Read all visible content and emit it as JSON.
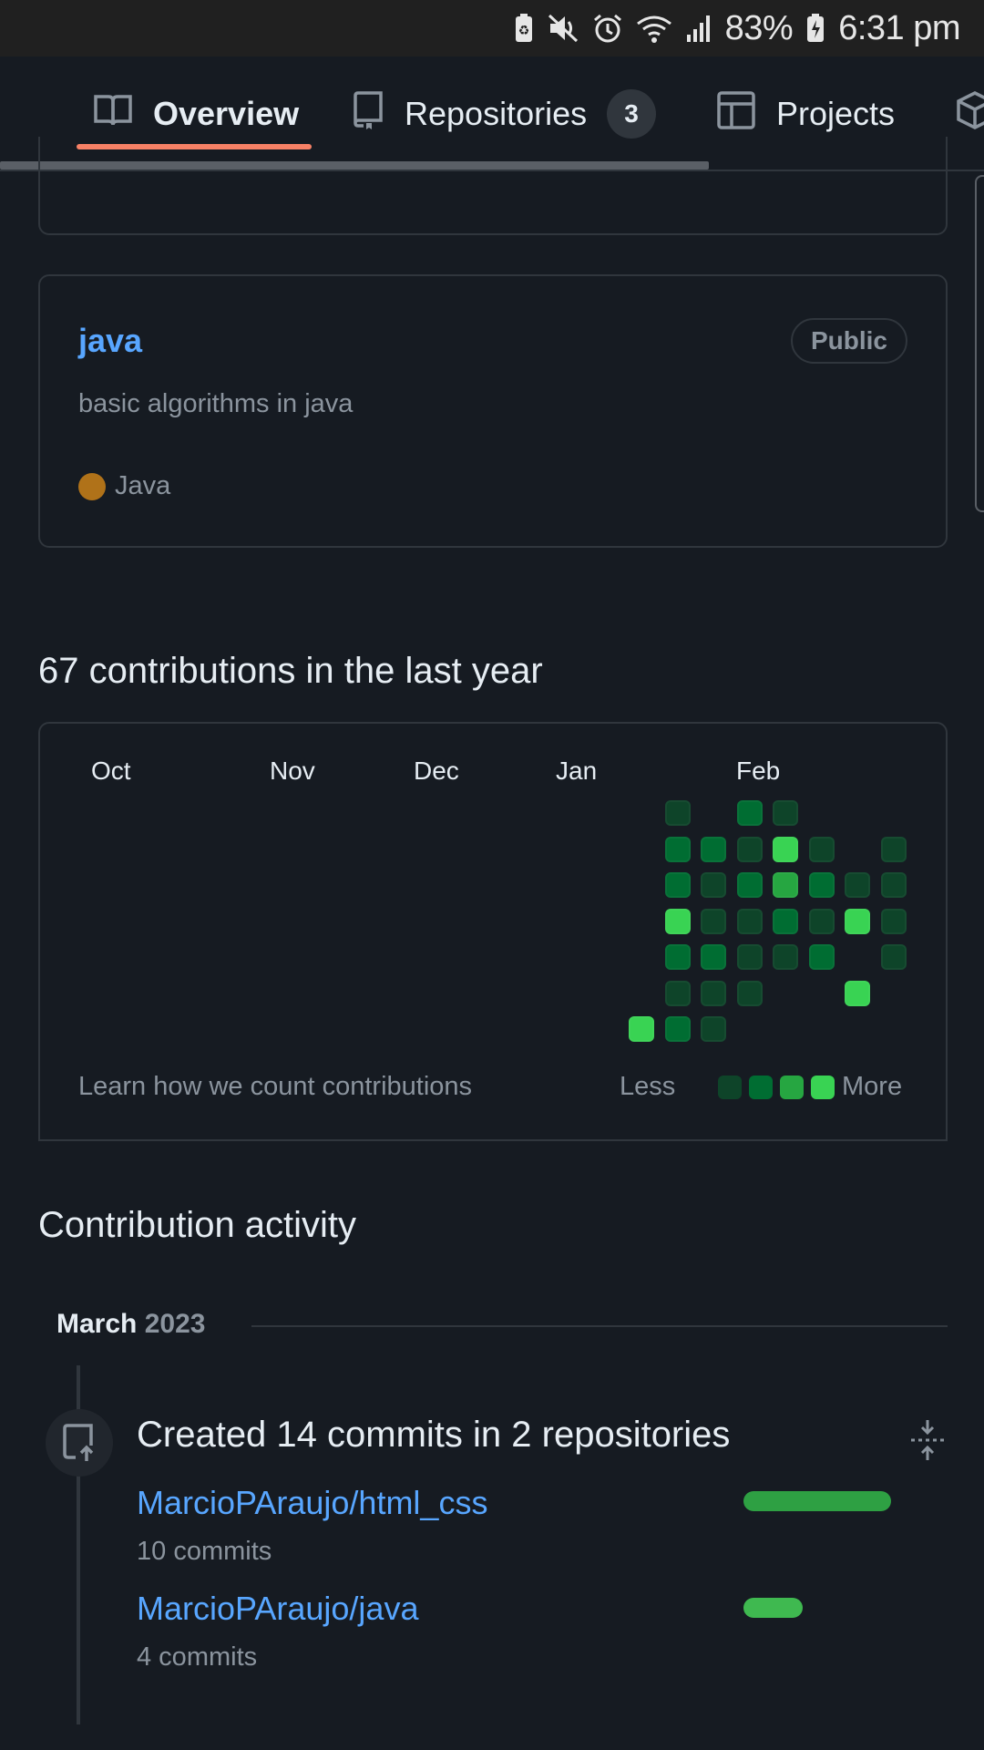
{
  "status_bar": {
    "battery_percent": "83%",
    "time": "6:31 pm",
    "icons": [
      "battery-saver-icon",
      "mute-icon",
      "alarm-icon",
      "wifi-icon",
      "signal-icon",
      "battery-charging-icon"
    ]
  },
  "tabs": [
    {
      "label": "Overview",
      "icon": "book-icon",
      "active": true
    },
    {
      "label": "Repositories",
      "icon": "repo-icon",
      "count": "3"
    },
    {
      "label": "Projects",
      "icon": "table-icon"
    },
    {
      "label": "",
      "icon": "package-icon"
    }
  ],
  "repo_card": {
    "name": "java",
    "visibility": "Public",
    "description": "basic algorithms in java",
    "language": "Java",
    "language_color": "#b07219"
  },
  "contributions": {
    "heading": "67 contributions in the last year",
    "months": [
      "Oct",
      "Nov",
      "Dec",
      "Jan",
      "Feb"
    ],
    "learn_link": "Learn how we count contributions",
    "legend_less": "Less",
    "legend_more": "More",
    "level_colors": [
      "#0e4429",
      "#006d32",
      "#26a641",
      "#39d353"
    ],
    "grid_columns": [
      {
        "week": 0,
        "days": [
          null,
          null,
          null,
          null,
          null,
          null,
          4
        ]
      },
      {
        "week": 1,
        "days": [
          1,
          2,
          2,
          4,
          2,
          1,
          2
        ]
      },
      {
        "week": 2,
        "days": [
          null,
          2,
          1,
          1,
          2,
          1,
          1
        ]
      },
      {
        "week": 3,
        "days": [
          2,
          1,
          2,
          1,
          1,
          1,
          null
        ]
      },
      {
        "week": 4,
        "days": [
          1,
          4,
          3,
          2,
          1,
          null,
          null
        ]
      },
      {
        "week": 5,
        "days": [
          null,
          1,
          2,
          1,
          2,
          null,
          null
        ]
      },
      {
        "week": 6,
        "days": [
          null,
          null,
          1,
          4,
          null,
          4,
          null
        ]
      },
      {
        "week": 7,
        "days": [
          null,
          1,
          1,
          1,
          1,
          null,
          null
        ]
      }
    ]
  },
  "activity": {
    "heading": "Contribution activity",
    "month": "March",
    "year": "2023",
    "summary": "Created 14 commits in 2 repositories",
    "repos": [
      {
        "name": "MarcioPAraujo/html_css",
        "commits": "10 commits",
        "share": 1.0
      },
      {
        "name": "MarcioPAraujo/java",
        "commits": "4 commits",
        "share": 0.4
      }
    ]
  }
}
